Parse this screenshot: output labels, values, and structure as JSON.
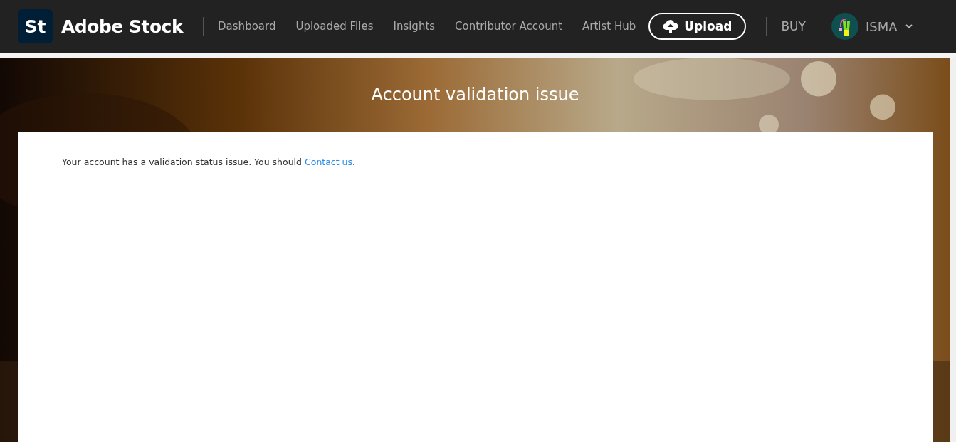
{
  "header": {
    "logo_mark": "St",
    "brand": "Adobe Stock",
    "nav": [
      {
        "label": "Dashboard"
      },
      {
        "label": "Uploaded Files"
      },
      {
        "label": "Insights"
      },
      {
        "label": "Contributor Account"
      },
      {
        "label": "Artist Hub"
      }
    ],
    "upload_button": "Upload",
    "buy": "BUY",
    "user": "ISMA"
  },
  "page": {
    "title": "Account validation issue",
    "message": {
      "text": "Your account has a validation status issue. You should ",
      "link": "Contact us",
      "after": "."
    }
  }
}
